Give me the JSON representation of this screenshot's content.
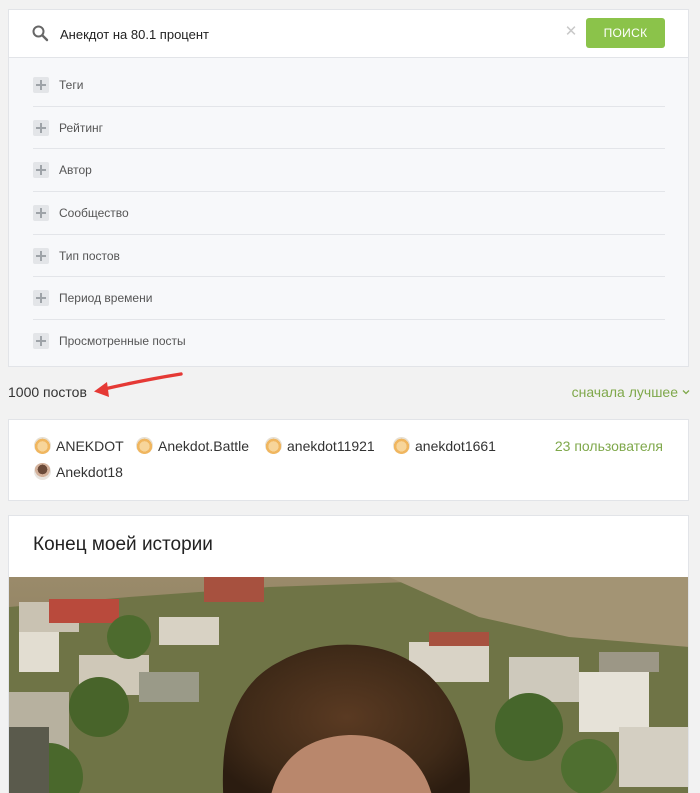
{
  "search": {
    "value": "Анекдот на 80.1 процент",
    "button_label": "ПОИСК"
  },
  "filters": [
    {
      "label": "Теги"
    },
    {
      "label": "Рейтинг"
    },
    {
      "label": "Автор"
    },
    {
      "label": "Сообщество"
    },
    {
      "label": "Тип постов"
    },
    {
      "label": "Период времени"
    },
    {
      "label": "Просмотренные посты"
    }
  ],
  "results": {
    "count_label": "1000 постов",
    "sort_label": "сначала лучшее"
  },
  "users": {
    "items": [
      {
        "name": "ANEKDOT",
        "avatar": "emoji-avatar"
      },
      {
        "name": "Anekdot.Battle",
        "avatar": "emoji-avatar"
      },
      {
        "name": "anekdot11921",
        "avatar": "emoji-avatar"
      },
      {
        "name": "anekdot1661",
        "avatar": "emoji-avatar"
      },
      {
        "name": "Anekdot18",
        "avatar": "photo-avatar"
      }
    ],
    "more_label": "23 пользователя"
  },
  "post": {
    "title": "Конец моей истории"
  },
  "colors": {
    "accent_green": "#8bc34a",
    "link_green": "#7fa84b",
    "annotation_red": "#e53935"
  },
  "icons": {
    "search": "search-icon",
    "clear": "close-icon",
    "filter_expand": "plus-icon",
    "sort": "chevron-down-icon"
  }
}
